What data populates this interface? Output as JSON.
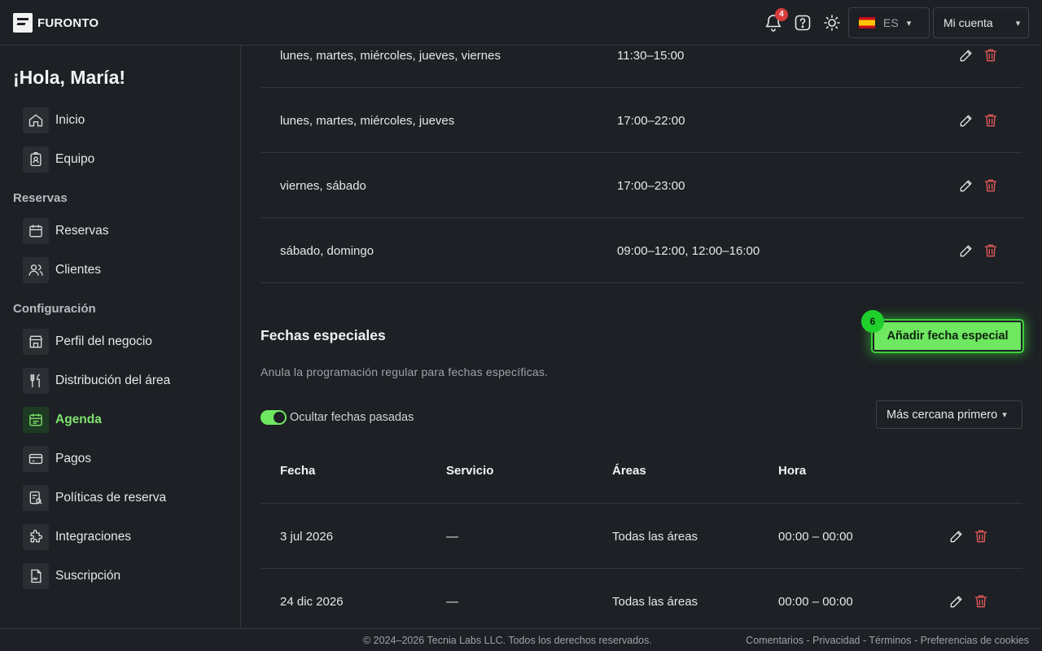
{
  "header": {
    "brand": "FURONTO",
    "notifications_count": "4",
    "language": "ES",
    "account_label": "Mi cuenta"
  },
  "sidebar": {
    "greeting": "¡Hola, María!",
    "top_items": [
      {
        "label": "Inicio",
        "icon": "home-icon"
      },
      {
        "label": "Equipo",
        "icon": "badge-icon"
      }
    ],
    "section_reservas": "Reservas",
    "reservas_items": [
      {
        "label": "Reservas",
        "icon": "calendar-icon"
      },
      {
        "label": "Clientes",
        "icon": "users-icon"
      }
    ],
    "section_config": "Configuración",
    "config_items": [
      {
        "label": "Perfil del negocio",
        "icon": "store-icon"
      },
      {
        "label": "Distribución del área",
        "icon": "utensils-icon"
      },
      {
        "label": "Agenda",
        "icon": "calendar-clock-icon",
        "active": true
      },
      {
        "label": "Pagos",
        "icon": "credit-card-icon"
      },
      {
        "label": "Políticas de reserva",
        "icon": "policy-icon"
      },
      {
        "label": "Integraciones",
        "icon": "puzzle-icon"
      },
      {
        "label": "Suscripción",
        "icon": "signature-icon"
      }
    ]
  },
  "schedule_rows": [
    {
      "days": "lunes, martes, miércoles, jueves, viernes",
      "hours": "11:30–15:00"
    },
    {
      "days": "lunes, martes, miércoles, jueves",
      "hours": "17:00–22:00"
    },
    {
      "days": "viernes, sábado",
      "hours": "17:00–23:00"
    },
    {
      "days": "sábado, domingo",
      "hours": "09:00–12:00, 12:00–16:00"
    }
  ],
  "special": {
    "title": "Fechas especiales",
    "description": "Anula la programación regular para fechas específicas.",
    "add_button": "Añadir fecha especial",
    "step_marker": "6",
    "toggle_label": "Ocultar fechas pasadas",
    "toggle_on": true,
    "sort_label": "Más cercana primero",
    "columns": [
      "Fecha",
      "Servicio",
      "Áreas",
      "Hora"
    ],
    "rows": [
      {
        "date": "3 jul 2026",
        "service": "—",
        "areas": "Todas las áreas",
        "time": "00:00 – 00:00"
      },
      {
        "date": "24 dic 2026",
        "service": "—",
        "areas": "Todas las áreas",
        "time": "00:00 – 00:00"
      }
    ]
  },
  "footer": {
    "copyright": "© 2024–2026 Tecnia Labs LLC. Todos los derechos reservados.",
    "links": "Comentarios - Privacidad - Términos - Preferencias de cookies"
  },
  "colors": {
    "accent": "#6ee860",
    "danger": "#e65a5a",
    "background": "#1d2024"
  }
}
